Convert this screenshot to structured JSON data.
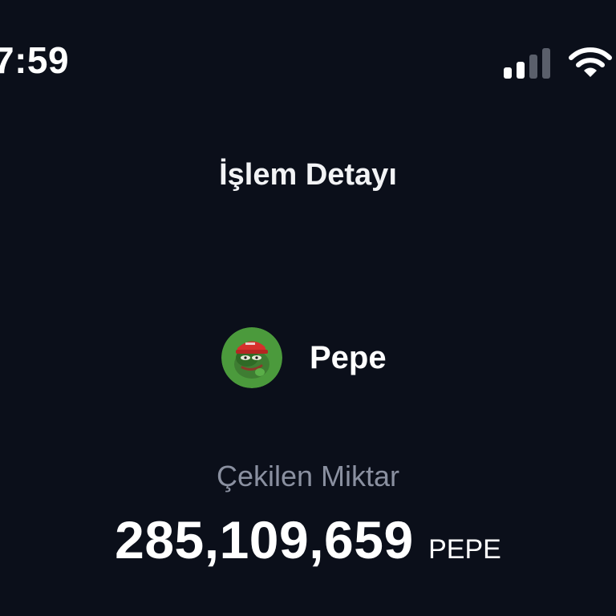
{
  "status_bar": {
    "time": "7:59",
    "signal_icon": "cellular-signal-icon",
    "wifi_icon": "wifi-icon"
  },
  "header": {
    "title": "İşlem Detayı"
  },
  "asset": {
    "name": "Pepe",
    "icon": "pepe-token-icon"
  },
  "amount": {
    "label": "Çekilen Miktar",
    "value": "285,109,659",
    "unit": "PEPE"
  },
  "colors": {
    "background": "#0b0f1a",
    "text_primary": "#ffffff",
    "text_secondary": "#8a90a0",
    "token_green": "#4b9a3c"
  }
}
